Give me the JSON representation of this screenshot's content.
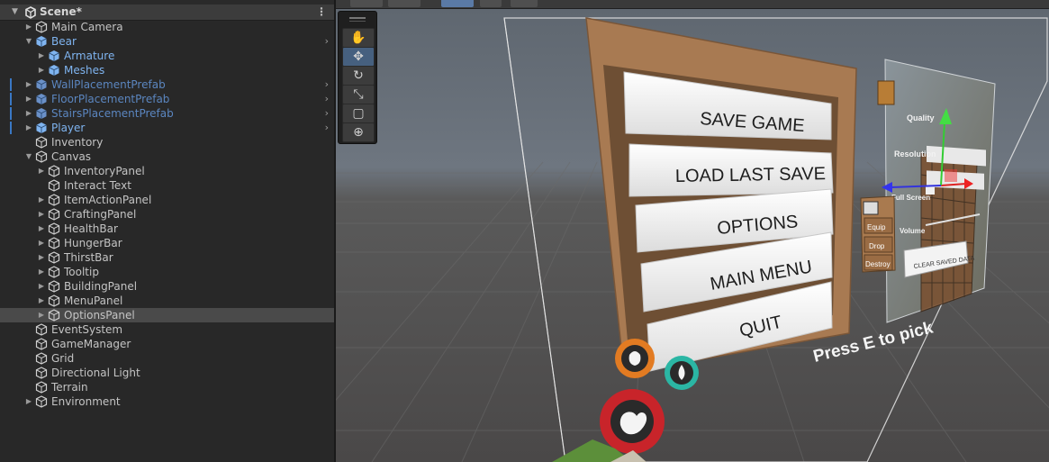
{
  "hierarchy": {
    "scene_name": "Scene*",
    "kebab": "⋮",
    "items": [
      {
        "label": "Main Camera",
        "depth": 1,
        "expandable": true,
        "expanded": false,
        "style": "normal",
        "chevron": false
      },
      {
        "label": "Bear",
        "depth": 1,
        "expandable": true,
        "expanded": true,
        "style": "blue",
        "chevron": true
      },
      {
        "label": "Armature",
        "depth": 2,
        "expandable": true,
        "expanded": false,
        "style": "blue",
        "chevron": false
      },
      {
        "label": "Meshes",
        "depth": 2,
        "expandable": true,
        "expanded": false,
        "style": "blue",
        "chevron": false
      },
      {
        "label": "WallPlacementPrefab",
        "depth": 1,
        "expandable": true,
        "expanded": false,
        "style": "prefab",
        "chevron": true,
        "marker": true
      },
      {
        "label": "FloorPlacementPrefab",
        "depth": 1,
        "expandable": true,
        "expanded": false,
        "style": "prefab",
        "chevron": true,
        "marker": true
      },
      {
        "label": "StairsPlacementPrefab",
        "depth": 1,
        "expandable": true,
        "expanded": false,
        "style": "prefab",
        "chevron": true,
        "marker": true
      },
      {
        "label": "Player",
        "depth": 1,
        "expandable": true,
        "expanded": false,
        "style": "blue",
        "chevron": true,
        "marker": true
      },
      {
        "label": "Inventory",
        "depth": 1,
        "expandable": false,
        "expanded": false,
        "style": "normal",
        "chevron": false
      },
      {
        "label": "Canvas",
        "depth": 1,
        "expandable": true,
        "expanded": true,
        "style": "normal",
        "chevron": false
      },
      {
        "label": "InventoryPanel",
        "depth": 2,
        "expandable": true,
        "expanded": false,
        "style": "normal",
        "chevron": false
      },
      {
        "label": "Interact Text",
        "depth": 2,
        "expandable": false,
        "expanded": false,
        "style": "normal",
        "chevron": false
      },
      {
        "label": "ItemActionPanel",
        "depth": 2,
        "expandable": true,
        "expanded": false,
        "style": "normal",
        "chevron": false
      },
      {
        "label": "CraftingPanel",
        "depth": 2,
        "expandable": true,
        "expanded": false,
        "style": "normal",
        "chevron": false
      },
      {
        "label": "HealthBar",
        "depth": 2,
        "expandable": true,
        "expanded": false,
        "style": "normal",
        "chevron": false
      },
      {
        "label": "HungerBar",
        "depth": 2,
        "expandable": true,
        "expanded": false,
        "style": "normal",
        "chevron": false
      },
      {
        "label": "ThirstBar",
        "depth": 2,
        "expandable": true,
        "expanded": false,
        "style": "normal",
        "chevron": false
      },
      {
        "label": "Tooltip",
        "depth": 2,
        "expandable": true,
        "expanded": false,
        "style": "normal",
        "chevron": false
      },
      {
        "label": "BuildingPanel",
        "depth": 2,
        "expandable": true,
        "expanded": false,
        "style": "normal",
        "chevron": false
      },
      {
        "label": "MenuPanel",
        "depth": 2,
        "expandable": true,
        "expanded": false,
        "style": "normal",
        "chevron": false
      },
      {
        "label": "OptionsPanel",
        "depth": 2,
        "expandable": true,
        "expanded": false,
        "style": "normal",
        "chevron": false,
        "selected": true
      },
      {
        "label": "EventSystem",
        "depth": 1,
        "expandable": false,
        "expanded": false,
        "style": "normal",
        "chevron": false
      },
      {
        "label": "GameManager",
        "depth": 1,
        "expandable": false,
        "expanded": false,
        "style": "normal",
        "chevron": false
      },
      {
        "label": "Grid",
        "depth": 1,
        "expandable": false,
        "expanded": false,
        "style": "normal",
        "chevron": false
      },
      {
        "label": "Directional Light",
        "depth": 1,
        "expandable": false,
        "expanded": false,
        "style": "normal",
        "chevron": false
      },
      {
        "label": "Terrain",
        "depth": 1,
        "expandable": false,
        "expanded": false,
        "style": "normal",
        "chevron": false
      },
      {
        "label": "Environment",
        "depth": 1,
        "expandable": true,
        "expanded": false,
        "style": "normal",
        "chevron": false
      }
    ]
  },
  "tools": [
    {
      "name": "hand-tool",
      "glyph": "✋",
      "active": false
    },
    {
      "name": "move-tool",
      "glyph": "✥",
      "active": true
    },
    {
      "name": "rotate-tool",
      "glyph": "↻",
      "active": false
    },
    {
      "name": "scale-tool",
      "glyph": "⤡",
      "active": false
    },
    {
      "name": "rect-tool",
      "glyph": "▢",
      "active": false
    },
    {
      "name": "transform-tool",
      "glyph": "⊕",
      "active": false
    }
  ],
  "game_ui": {
    "menu_buttons": [
      "SAVE GAME",
      "LOAD LAST SAVE",
      "OPTIONS",
      "MAIN MENU",
      "QUIT"
    ],
    "options": {
      "quality_label": "Quality",
      "resolution_label": "Resolution",
      "fullscreen_label": "Full Screen",
      "volume_label": "Volume",
      "clear_button": "CLEAR SAVED DATA"
    },
    "item_actions": [
      "Equip",
      "Drop",
      "Destroy"
    ],
    "interact_text": "Press E to pick",
    "colors": {
      "panel_brown": "#a87a52",
      "panel_dark": "#6e4f34",
      "health_red": "#c8242a",
      "hunger_orange": "#e27b22",
      "thirst_teal": "#2bb6a4",
      "selection_blue": "#3a78c4"
    }
  }
}
